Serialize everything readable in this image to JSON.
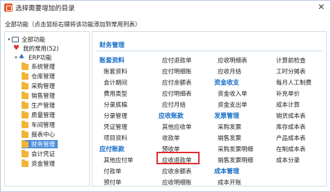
{
  "window": {
    "title": "选择需要增加的目录",
    "close_glyph": "✕"
  },
  "hint": "全部功能（点击鼠标右键将该功能添加到常用列表）",
  "tree": {
    "root": "全部功能",
    "favorites": "我的常用(52)",
    "erp": "ERP功能",
    "modules": [
      "系统管理",
      "仓库管理",
      "采购管理",
      "销售管理",
      "生产管理",
      "质量管理",
      "车间管理",
      "报表中心",
      "财务管理",
      "会计凭证",
      "资金管理"
    ],
    "selected_index": 8
  },
  "section": {
    "title": "财务管理"
  },
  "columns": {
    "col1": {
      "groups": [
        {
          "header": "账套资料",
          "items": [
            "账套资料",
            "会计期间",
            "费用类型",
            "分录底稿",
            "分录管理",
            "凭证管理",
            "项目资料"
          ]
        },
        {
          "header": "应付账款",
          "items": [
            "其他应付单",
            "付款单",
            "预付单"
          ]
        }
      ]
    },
    "col2": {
      "items_top": [
        "应付退款单",
        "应付明细账",
        "应付余额表",
        "应付明细表",
        "应付月结"
      ],
      "group": {
        "header": "应收账款",
        "items": [
          "其他应收单",
          "收款单",
          "预收单",
          "应收退款单",
          "应收余额表",
          "应收明细账"
        ]
      }
    },
    "col3": {
      "items_top": [
        "应收明细表",
        "应收月结"
      ],
      "groups": [
        {
          "header": "资金收支",
          "items": [
            "资金收入单",
            "资金支出单"
          ]
        },
        {
          "header": "发票管理",
          "items": [
            "采购发票",
            "销售发票",
            "采购发票明细",
            "销售发票明细"
          ]
        },
        {
          "header": "成本管理",
          "items": [
            "成本开账"
          ]
        }
      ]
    },
    "col4": {
      "items": [
        "计算前检查",
        "工时分摊表",
        "每月人工制费",
        "补充单价",
        "成本计算",
        "销货成本表",
        "库存成本表",
        "产品成本表",
        "在制成本表",
        "成本分录"
      ]
    }
  },
  "highlight": {
    "item": "应收退款单",
    "color": "#e02a2a"
  },
  "colors": {
    "accent": "#1a6fc7",
    "selected_bg": "#4a8fdb",
    "folder": "#f2b437"
  },
  "icons": {
    "app": "window-icon",
    "root": "monitor-icon",
    "favorites": "heart-icon",
    "erp": "org-chart-icon",
    "module": "folder-icon"
  }
}
